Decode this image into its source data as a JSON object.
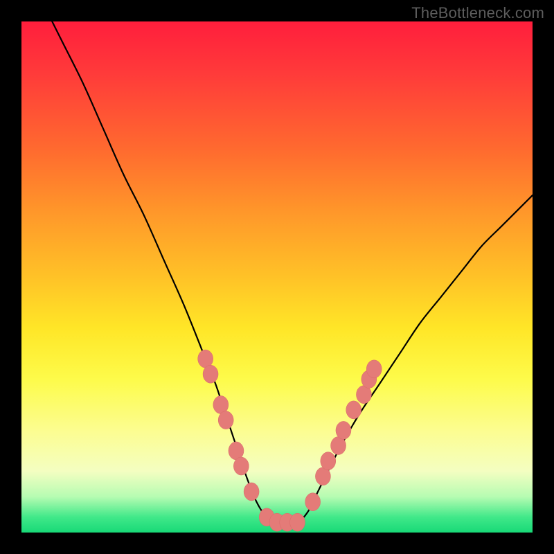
{
  "watermark": {
    "text": "TheBottleneck.com"
  },
  "colors": {
    "page_bg": "#000000",
    "curve_stroke": "#000000",
    "marker_fill": "#e47b78",
    "marker_stroke": "#d86a67"
  },
  "chart_data": {
    "type": "line",
    "title": "",
    "xlabel": "",
    "ylabel": "",
    "xlim": [
      0,
      100
    ],
    "ylim": [
      0,
      100
    ],
    "grid": false,
    "legend": false,
    "annotations": [],
    "series": [
      {
        "name": "curve",
        "x": [
          6,
          8,
          12,
          16,
          20,
          24,
          28,
          32,
          36,
          38,
          40,
          42,
          44,
          46,
          48,
          50,
          52,
          54,
          56,
          58,
          62,
          66,
          70,
          74,
          78,
          82,
          86,
          90,
          94,
          98,
          100
        ],
        "y": [
          100,
          96,
          88,
          79,
          70,
          62,
          53,
          44,
          34,
          29,
          23,
          17,
          11,
          6,
          3,
          2,
          2,
          2,
          4,
          8,
          16,
          23,
          29,
          35,
          41,
          46,
          51,
          56,
          60,
          64,
          66
        ]
      }
    ],
    "markers": [
      {
        "series": "curve",
        "x": 36,
        "y": 34
      },
      {
        "series": "curve",
        "x": 37,
        "y": 31
      },
      {
        "series": "curve",
        "x": 39,
        "y": 25
      },
      {
        "series": "curve",
        "x": 40,
        "y": 22
      },
      {
        "series": "curve",
        "x": 42,
        "y": 16
      },
      {
        "series": "curve",
        "x": 43,
        "y": 13
      },
      {
        "series": "curve",
        "x": 45,
        "y": 8
      },
      {
        "series": "curve",
        "x": 48,
        "y": 3
      },
      {
        "series": "curve",
        "x": 50,
        "y": 2
      },
      {
        "series": "curve",
        "x": 52,
        "y": 2
      },
      {
        "series": "curve",
        "x": 54,
        "y": 2
      },
      {
        "series": "curve",
        "x": 57,
        "y": 6
      },
      {
        "series": "curve",
        "x": 59,
        "y": 11
      },
      {
        "series": "curve",
        "x": 60,
        "y": 14
      },
      {
        "series": "curve",
        "x": 62,
        "y": 17
      },
      {
        "series": "curve",
        "x": 63,
        "y": 20
      },
      {
        "series": "curve",
        "x": 65,
        "y": 24
      },
      {
        "series": "curve",
        "x": 67,
        "y": 27
      },
      {
        "series": "curve",
        "x": 68,
        "y": 30
      },
      {
        "series": "curve",
        "x": 69,
        "y": 32
      }
    ]
  }
}
